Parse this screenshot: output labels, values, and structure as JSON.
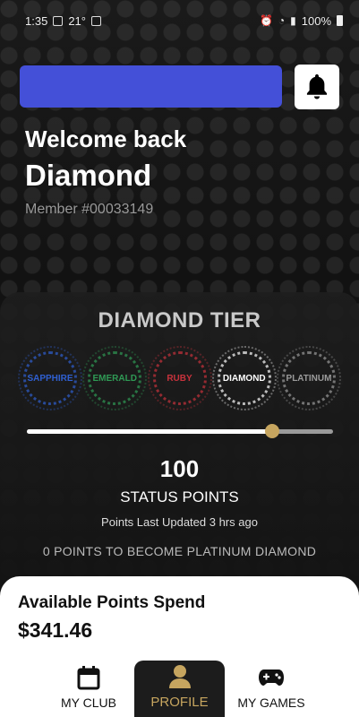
{
  "status_bar": {
    "time": "1:35",
    "temp": "21°",
    "battery": "100%"
  },
  "header": {
    "banner_color": "#4450d8",
    "bell_icon": "bell-icon"
  },
  "welcome": {
    "greeting": "Welcome back",
    "name": "Diamond",
    "member": "Member #00033149"
  },
  "tier": {
    "title": "DIAMOND TIER",
    "badges": [
      {
        "label": "SAPPHIRE",
        "color": "#2f5fd0"
      },
      {
        "label": "EMERALD",
        "color": "#2f9a55"
      },
      {
        "label": "RUBY",
        "color": "#c8323c"
      },
      {
        "label": "DIAMOND",
        "color": "#ffffff"
      },
      {
        "label": "PLATINUM",
        "color": "#9a9a9a"
      }
    ],
    "progress": 0.8
  },
  "points": {
    "value": "100",
    "label": "STATUS POINTS",
    "updated": "Points Last Updated 3 hrs ago",
    "next": "0 POINTS TO BECOME PLATINUM DIAMOND"
  },
  "spend": {
    "label": "Available Points Spend",
    "value": "$341.46"
  },
  "nav": {
    "items": [
      {
        "label": "MY CLUB",
        "icon": "calendar-icon"
      },
      {
        "label": "PROFILE",
        "icon": "person-icon"
      },
      {
        "label": "MY GAMES",
        "icon": "gamepad-icon"
      }
    ]
  },
  "colors": {
    "accent_gold": "#c6a55f",
    "banner_blue": "#4450d8"
  }
}
